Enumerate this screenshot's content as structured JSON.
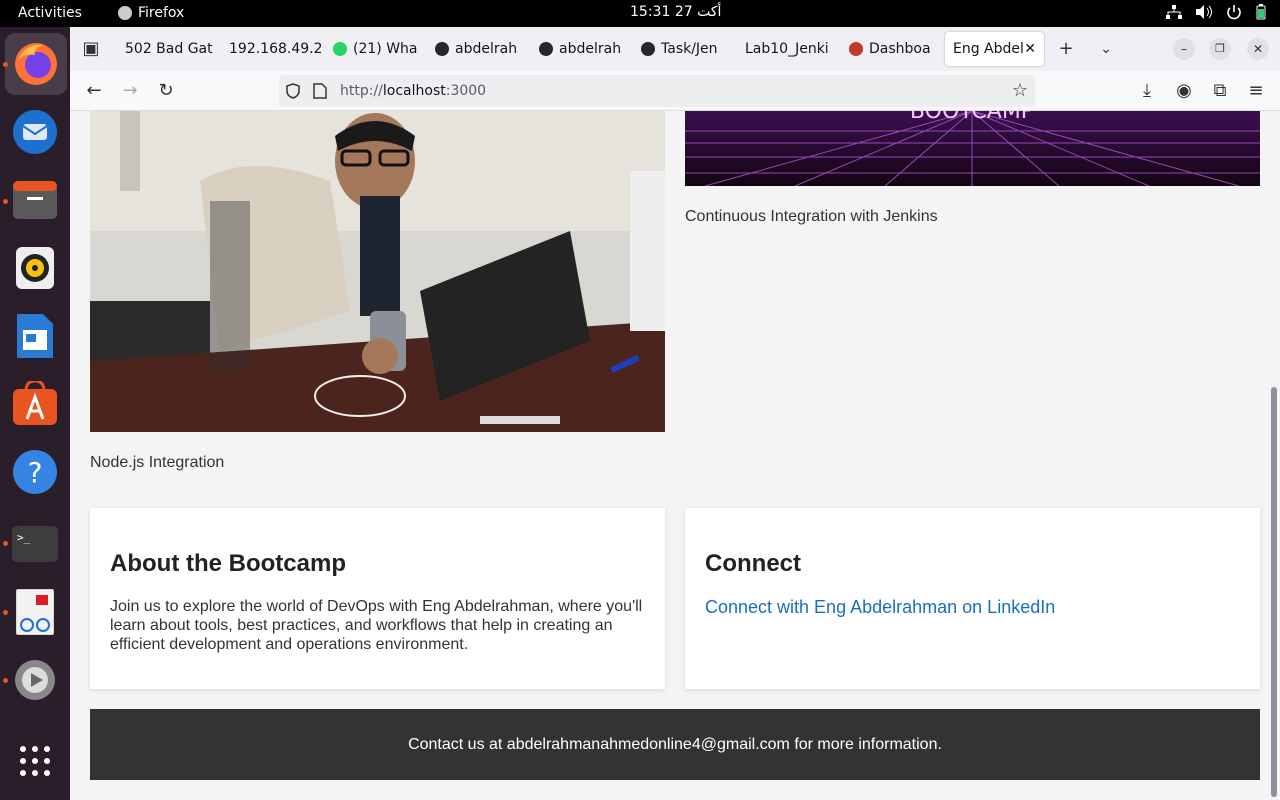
{
  "system": {
    "activities": "Activities",
    "app_name": "Firefox",
    "clock": "أكت 27  15:31"
  },
  "tabs": [
    {
      "label": "502 Bad Gat",
      "color": "#888"
    },
    {
      "label": "192.168.49.2",
      "color": "#888"
    },
    {
      "label": "(21) Wha",
      "color": "#25d366",
      "badge": "21"
    },
    {
      "label": "abdelrah",
      "color": "#24292f"
    },
    {
      "label": "abdelrah",
      "color": "#24292f"
    },
    {
      "label": "Task/Jen",
      "color": "#24292f"
    },
    {
      "label": "Lab10_Jenki",
      "color": "#888"
    },
    {
      "label": "Dashboa",
      "color": "#c0392b"
    },
    {
      "label": "Eng Abdel",
      "color": "#fff",
      "active": true
    }
  ],
  "address": {
    "scheme": "http://",
    "host": "localhost",
    "port": ":3000"
  },
  "page": {
    "caption_left": "Node.js Integration",
    "caption_right": "Continuous Integration with Jenkins",
    "banner_text": "BOOTCAMP",
    "about": {
      "title": "About the Bootcamp",
      "body": "Join us to explore the world of DevOps with Eng Abdelrahman, where you'll learn about tools, best practices, and workflows that help in creating an efficient development and operations environment."
    },
    "connect": {
      "title": "Connect",
      "link": "Connect with Eng Abdelrahman on LinkedIn"
    },
    "footer": "Contact us at abdelrahmanahmedonline4@gmail.com for more information."
  },
  "colors": {
    "link": "#1a6ec1",
    "footer_bg": "#333333",
    "dock_bg": "#2b1e2b",
    "accent": "#e95420"
  }
}
